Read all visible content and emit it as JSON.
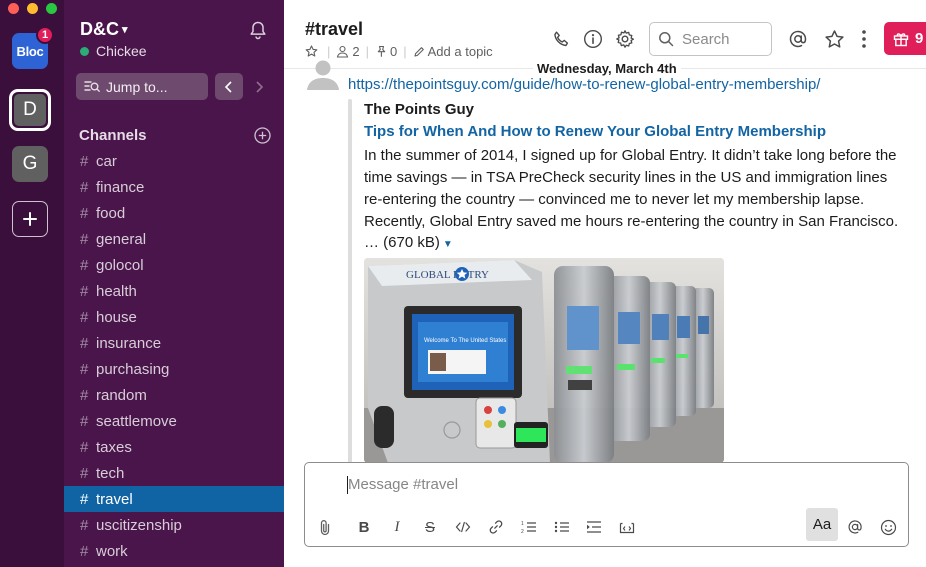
{
  "rail": {
    "workspaces": [
      {
        "label": "Bloc",
        "badge": "1"
      },
      {
        "label": "D"
      },
      {
        "label": "G"
      }
    ],
    "add_label": "+"
  },
  "sidebar": {
    "workspace_name": "D&C",
    "user_name": "Chickee",
    "jump_label": "Jump to...",
    "channels_header": "Channels",
    "channels": [
      "car",
      "finance",
      "food",
      "general",
      "golocol",
      "health",
      "house",
      "insurance",
      "purchasing",
      "random",
      "seattlemove",
      "taxes",
      "tech",
      "travel",
      "uscitizenship",
      "work"
    ],
    "active_channel": "travel"
  },
  "header": {
    "channel_title": "#travel",
    "member_count": "2",
    "pin_count": "0",
    "add_topic": "Add a topic",
    "search_placeholder": "Search",
    "gift_count": "9"
  },
  "messages": {
    "date_divider": "Wednesday, March 4th",
    "url": "https://thepointsguy.com/guide/how-to-renew-global-entry-membership/",
    "unfurl": {
      "site": "The Points Guy",
      "title": "Tips for When And How to Renew Your Global Entry Membership",
      "description": "In the summer of 2014, I signed up for Global Entry. It didn’t take long before the time savings — in TSA PreCheck security lines in the US and immigration lines re-entering the country — convinced me to never let my membership lapse. Recently, Global Entry saved me hours re-entering the country in San Francisco.",
      "size": "… (670 kB)",
      "image_sign": "GLOBAL ENTRY",
      "image_screen": "Welcome To The United States"
    }
  },
  "composer": {
    "placeholder": "Message #travel",
    "format_label": "Aa"
  },
  "colors": {
    "rail_bg": "#3b0f3c",
    "sidebar_bg": "#4a154b",
    "active_channel": "#1164a3",
    "link": "#1264a3",
    "badge": "#e01e5a",
    "presence": "#2bac76"
  }
}
